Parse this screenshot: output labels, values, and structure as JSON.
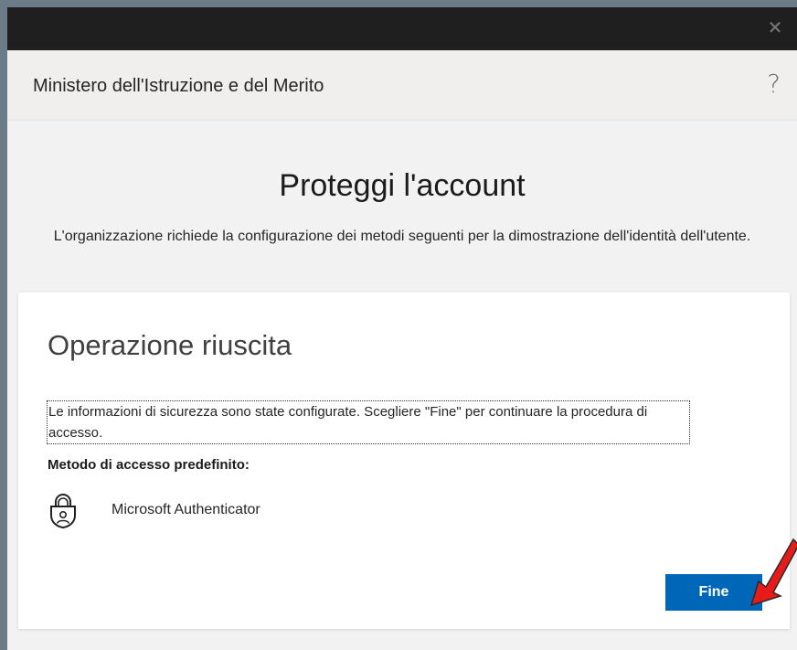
{
  "window": {
    "close_glyph": "✕"
  },
  "header": {
    "org_name": "Ministero dell'Istruzione e del Merito",
    "help_glyph": "?"
  },
  "main": {
    "title": "Proteggi l'account",
    "subtitle": "L'organizzazione richiede la configurazione dei metodi seguenti per la dimostrazione dell'identità dell'utente."
  },
  "card": {
    "title": "Operazione riuscita",
    "message": "Le informazioni di sicurezza sono state configurate. Scegliere \"Fine\" per continuare la procedura di accesso.",
    "method_heading": "Metodo di accesso predefinito:",
    "method_name": "Microsoft Authenticator",
    "method_icon": "authenticator-lock-icon",
    "finish_label": "Fine"
  },
  "colors": {
    "primary_button": "#0067b8",
    "titlebar": "#1f1f1f",
    "annotation_arrow": "#e81b1b"
  }
}
